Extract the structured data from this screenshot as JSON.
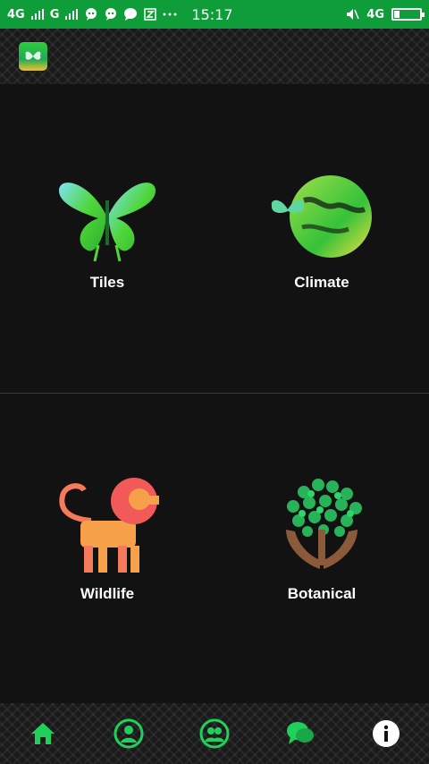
{
  "status_bar": {
    "left_network_1": "4G",
    "left_network_2": "G",
    "time": "15:17",
    "right_network": "4G",
    "icons": [
      "sim-signal-icon",
      "chat-bubble-icon",
      "chat-bubble-icon",
      "message-icon",
      "notification-icon",
      "more-dots-icon",
      "mute-icon",
      "battery-icon"
    ],
    "battery_level": 0.2
  },
  "colors": {
    "status_bar": "#0f9d3a",
    "background": "#121212",
    "accent_green": "#1fd05a"
  },
  "tiles": [
    {
      "label": "Tiles",
      "icon": "butterfly-icon"
    },
    {
      "label": "Climate",
      "icon": "globe-icon"
    },
    {
      "label": "Wildlife",
      "icon": "lion-icon"
    },
    {
      "label": "Botanical",
      "icon": "tree-hands-icon"
    }
  ],
  "bottom_nav": [
    {
      "icon": "home-icon"
    },
    {
      "icon": "user-icon"
    },
    {
      "icon": "group-icon"
    },
    {
      "icon": "chat-icon"
    },
    {
      "icon": "info-icon"
    }
  ]
}
